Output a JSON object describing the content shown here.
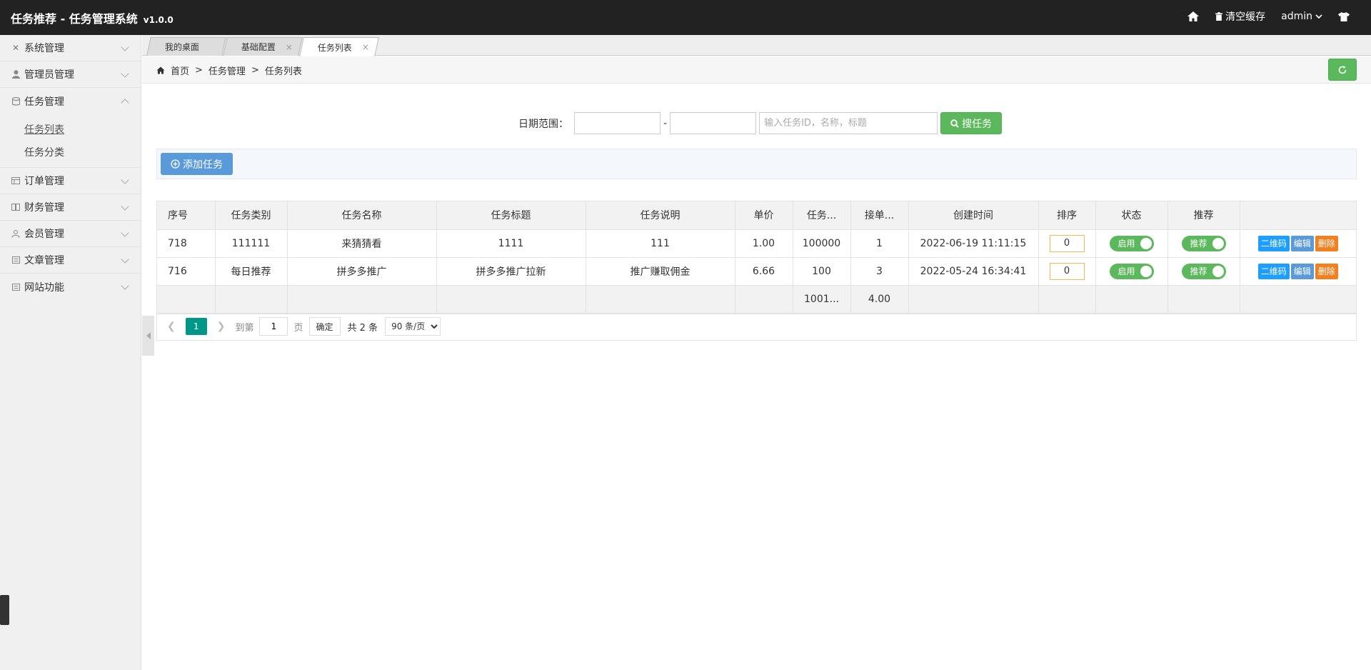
{
  "header": {
    "title": "任务推荐 - 任务管理系统",
    "version": "v1.0.0",
    "clear_cache": "清空缓存",
    "user": "admin"
  },
  "sidebar": {
    "items": [
      {
        "label": "系统管理",
        "icon": "wrench-icon"
      },
      {
        "label": "管理员管理",
        "icon": "user-icon"
      },
      {
        "label": "任务管理",
        "icon": "database-icon"
      },
      {
        "label": "订单管理",
        "icon": "table-icon"
      },
      {
        "label": "财务管理",
        "icon": "book-icon"
      },
      {
        "label": "会员管理",
        "icon": "users-icon"
      },
      {
        "label": "文章管理",
        "icon": "list-icon"
      },
      {
        "label": "网站功能",
        "icon": "list-icon"
      }
    ],
    "sub_items": [
      {
        "label": "任务列表"
      },
      {
        "label": "任务分类"
      }
    ]
  },
  "tabs": [
    {
      "label": "我的桌面"
    },
    {
      "label": "基础配置"
    },
    {
      "label": "任务列表"
    }
  ],
  "breadcrumb": [
    "首页",
    "任务管理",
    "任务列表"
  ],
  "search": {
    "date_label": "日期范围：",
    "date_from": "",
    "date_to": "",
    "placeholder": "输入任务ID，名称，标题",
    "button": "搜任务"
  },
  "toolbar": {
    "add_label": "添加任务"
  },
  "table": {
    "headers": [
      "序号",
      "任务类别",
      "任务名称",
      "任务标题",
      "任务说明",
      "单价",
      "任务...",
      "接单...",
      "创建时间",
      "排序",
      "状态",
      "推荐",
      ""
    ],
    "rows": [
      {
        "id": "718",
        "category": "111111",
        "name": "来猜猜看",
        "title": "1111",
        "desc": "111",
        "price": "1.00",
        "total": "100000",
        "taken": "1",
        "created": "2022-06-19 11:11:15",
        "sort": "0",
        "status": "启用",
        "recommend": "推荐"
      },
      {
        "id": "716",
        "category": "每日推荐",
        "name": "拼多多推广",
        "title": "拼多多推广拉新",
        "desc": "推广赚取佣金",
        "price": "6.66",
        "total": "100",
        "taken": "3",
        "created": "2022-05-24 16:34:41",
        "sort": "0",
        "status": "启用",
        "recommend": "推荐"
      }
    ],
    "totals": {
      "total": "1001...",
      "taken": "4.00"
    },
    "actions": {
      "qr": "二维码",
      "edit": "编辑",
      "delete": "删除"
    }
  },
  "pager": {
    "current": "1",
    "goto_label": "到第",
    "page_value": "1",
    "page_unit": "页",
    "confirm": "确定",
    "total": "共 2 条",
    "per_page": "90 条/页"
  },
  "colors": {
    "header_bg": "#222222",
    "green": "#5cb85c",
    "blue": "#5a9ad8",
    "teal": "#009688",
    "orange": "#f0811e"
  }
}
